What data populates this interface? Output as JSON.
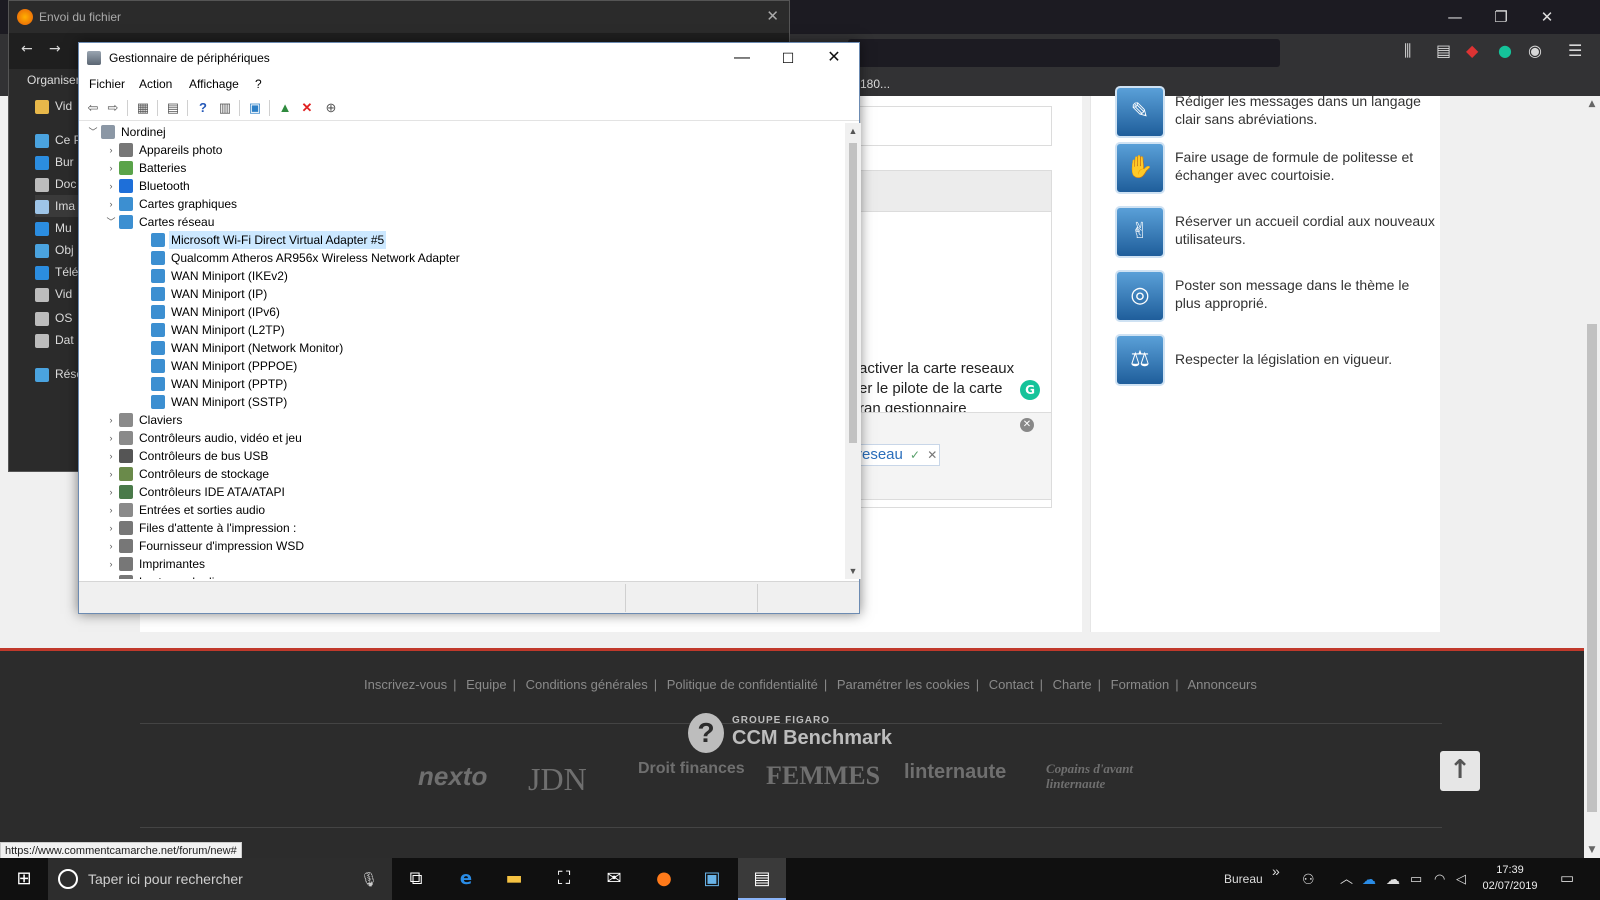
{
  "firefox": {
    "bookmark_partial": "180...",
    "status_url": "https://www.commentcamarche.net/forum/new#"
  },
  "upload_dialog": {
    "title": "Envoi du fichier",
    "organize": "Organiser",
    "sidebar": [
      {
        "label": "Vid",
        "icon": "folder-icon",
        "color": "#e8b84a"
      },
      {
        "label": "Ce P",
        "icon": "computer-icon",
        "color": "#4aa3df"
      },
      {
        "label": "Bur",
        "icon": "desktop-icon",
        "color": "#2b8de0"
      },
      {
        "label": "Doc",
        "icon": "documents-icon",
        "color": "#bcbcbc"
      },
      {
        "label": "Ima",
        "icon": "pictures-icon",
        "color": "#9ec5e8"
      },
      {
        "label": "Mu",
        "icon": "music-icon",
        "color": "#2b8de0"
      },
      {
        "label": "Obj",
        "icon": "3d-objects-icon",
        "color": "#4aa3df"
      },
      {
        "label": "Télé",
        "icon": "downloads-icon",
        "color": "#2b8de0"
      },
      {
        "label": "Vid",
        "icon": "videos-icon",
        "color": "#bcbcbc"
      },
      {
        "label": "OS",
        "icon": "drive-icon",
        "color": "#bcbcbc"
      },
      {
        "label": "Dat",
        "icon": "drive-icon",
        "color": "#bcbcbc"
      },
      {
        "label": "Rése",
        "icon": "network-icon",
        "color": "#4aa3df"
      }
    ]
  },
  "device_manager": {
    "title": "Gestionnaire de périphériques",
    "menu": [
      "Fichier",
      "Action",
      "Affichage",
      "?"
    ],
    "root": "Nordinej",
    "tree": [
      {
        "label": "Appareils photo",
        "level": 1,
        "expanded": false,
        "color": "#777777"
      },
      {
        "label": "Batteries",
        "level": 1,
        "expanded": false,
        "color": "#5aa34a"
      },
      {
        "label": "Bluetooth",
        "level": 1,
        "expanded": false,
        "color": "#1e6fd9"
      },
      {
        "label": "Cartes graphiques",
        "level": 1,
        "expanded": false,
        "color": "#3c8fd1"
      },
      {
        "label": "Cartes réseau",
        "level": 1,
        "expanded": true,
        "color": "#3c8fd1"
      },
      {
        "label": "Microsoft Wi-Fi Direct Virtual Adapter #5",
        "level": 2,
        "selected": true,
        "color": "#3c8fd1"
      },
      {
        "label": "Qualcomm Atheros AR956x Wireless Network Adapter",
        "level": 2,
        "color": "#3c8fd1"
      },
      {
        "label": "WAN Miniport (IKEv2)",
        "level": 2,
        "color": "#3c8fd1"
      },
      {
        "label": "WAN Miniport (IP)",
        "level": 2,
        "color": "#3c8fd1"
      },
      {
        "label": "WAN Miniport (IPv6)",
        "level": 2,
        "color": "#3c8fd1"
      },
      {
        "label": "WAN Miniport (L2TP)",
        "level": 2,
        "color": "#3c8fd1"
      },
      {
        "label": "WAN Miniport (Network Monitor)",
        "level": 2,
        "color": "#3c8fd1"
      },
      {
        "label": "WAN Miniport (PPPOE)",
        "level": 2,
        "color": "#3c8fd1"
      },
      {
        "label": "WAN Miniport (PPTP)",
        "level": 2,
        "color": "#3c8fd1"
      },
      {
        "label": "WAN Miniport (SSTP)",
        "level": 2,
        "color": "#3c8fd1"
      },
      {
        "label": "Claviers",
        "level": 1,
        "expanded": false,
        "color": "#8a8a8a"
      },
      {
        "label": "Contrôleurs audio, vidéo et jeu",
        "level": 1,
        "expanded": false,
        "color": "#8a8a8a"
      },
      {
        "label": "Contrôleurs de bus USB",
        "level": 1,
        "expanded": false,
        "color": "#555555"
      },
      {
        "label": "Contrôleurs de stockage",
        "level": 1,
        "expanded": false,
        "color": "#6a8a4a"
      },
      {
        "label": "Contrôleurs IDE ATA/ATAPI",
        "level": 1,
        "expanded": false,
        "color": "#4a7a4a"
      },
      {
        "label": "Entrées et sorties audio",
        "level": 1,
        "expanded": false,
        "color": "#8a8a8a"
      },
      {
        "label": "Files d'attente à l'impression :",
        "level": 1,
        "expanded": false,
        "color": "#777777"
      },
      {
        "label": "Fournisseur d'impression WSD",
        "level": 1,
        "expanded": false,
        "color": "#777777"
      },
      {
        "label": "Imprimantes",
        "level": 1,
        "expanded": false,
        "color": "#777777"
      },
      {
        "label": "Lecteurs de disque",
        "level": 1,
        "expanded": false,
        "color": "#777777"
      }
    ]
  },
  "editor": {
    "lines": [
      "activer la carte reseaux",
      "er le pilote de la carte",
      "ran gestionnaire"
    ],
    "tag": "reseau"
  },
  "rules": [
    {
      "text": "Rédiger les messages dans un langage clair sans abréviations.",
      "icon": "pen-icon"
    },
    {
      "text": "Faire usage de formule de politesse et échanger avec courtoisie.",
      "icon": "praying-hands-icon"
    },
    {
      "text": "Réserver un accueil cordial aux nouveaux utilisateurs.",
      "icon": "handshake-icon"
    },
    {
      "text": "Poster son message dans le thème le plus approprié.",
      "icon": "target-icon"
    },
    {
      "text": "Respecter la législation en vigueur.",
      "icon": "gavel-icon"
    }
  ],
  "footer": {
    "links": [
      "Inscrivez-vous",
      "Equipe",
      "Conditions générales",
      "Politique de confidentialité",
      "Paramétrer les cookies",
      "Contact",
      "Charte",
      "Formation",
      "Annonceurs"
    ],
    "group": "GROUPE FIGARO",
    "brand": "CCM Benchmark",
    "partners": [
      "nexto",
      "JDN",
      "Droit finances",
      "FEMMES",
      "linternaute",
      "Copains d'avant linternaute"
    ]
  },
  "taskbar": {
    "search_placeholder": "Taper ici pour rechercher",
    "desktop": "Bureau",
    "time": "17:39",
    "date": "02/07/2019"
  }
}
